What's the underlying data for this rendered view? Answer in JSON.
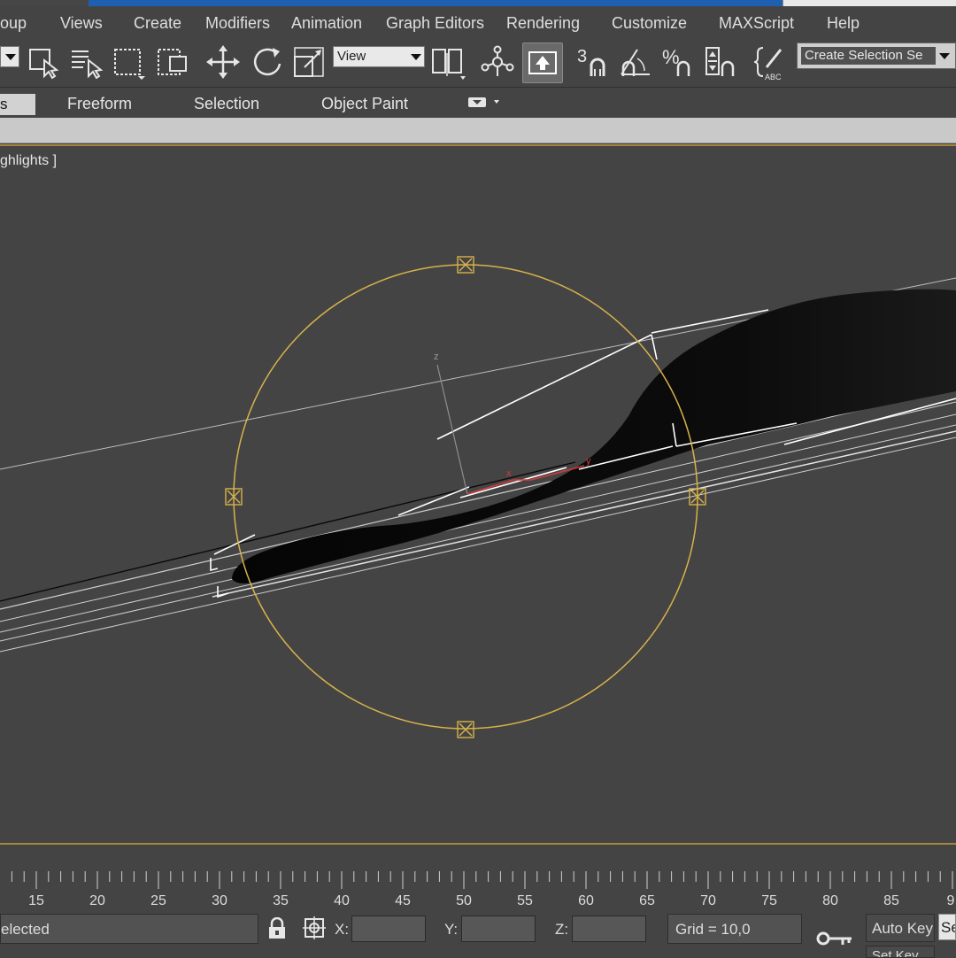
{
  "menubar": {
    "items": [
      "oup",
      "Views",
      "Create",
      "Modifiers",
      "Animation",
      "Graph Editors",
      "Rendering",
      "Customize",
      "MAXScript",
      "Help"
    ]
  },
  "toolbar": {
    "reference_coord_value": "View",
    "named_selection_value": "Create Selection Se",
    "snap_angle_label": "3",
    "percent_snap_label": "%",
    "spinner_snap_label": "ABC"
  },
  "ribbon": {
    "active_tab_partial": "s",
    "tabs": [
      "Freeform",
      "Selection",
      "Object Paint"
    ]
  },
  "viewport": {
    "label_partial": "ghlights ]",
    "axis_labels": {
      "x": "x",
      "y": "y",
      "z": "z"
    },
    "colors": {
      "selection_gizmo": "#d8b24a",
      "active_border": "#a4863a",
      "axis_x": "#d43a3a",
      "wireframe": "#ffffff"
    }
  },
  "timeline": {
    "ticks": [
      "15",
      "20",
      "25",
      "30",
      "35",
      "40",
      "45",
      "50",
      "55",
      "60",
      "65",
      "70",
      "75",
      "80",
      "85",
      "9"
    ]
  },
  "statusbar": {
    "selection_text": "elected",
    "x_label": "X:",
    "y_label": "Y:",
    "z_label": "Z:",
    "x_value": "",
    "y_value": "",
    "z_value": "",
    "grid_text": "Grid = 10,0",
    "auto_key_label": "Auto Key",
    "set_key_label": "Set Key",
    "selected_partial": "Se",
    "icons": [
      "lock-icon",
      "absolute-mode-icon",
      "key-icon"
    ]
  }
}
